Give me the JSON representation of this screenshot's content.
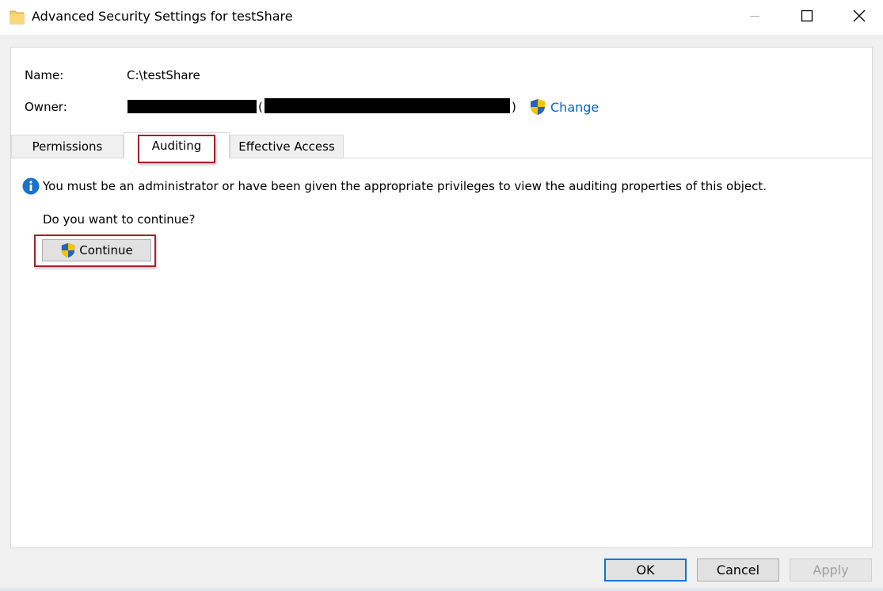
{
  "window": {
    "title": "Advanced Security Settings for testShare",
    "controls": {
      "minimize": "minimize-icon",
      "maximize": "maximize-icon",
      "close": "close-icon"
    }
  },
  "object": {
    "name_label": "Name:",
    "name_value": "C:\\testShare",
    "owner_label": "Owner:",
    "owner_paren_open": "(",
    "owner_paren_close": ")",
    "change_link": "Change"
  },
  "tabs": [
    {
      "label": "Permissions",
      "selected": false
    },
    {
      "label": "Auditing",
      "selected": true
    },
    {
      "label": "Effective Access",
      "selected": false
    }
  ],
  "auditing": {
    "info_message": "You must be an administrator or have been given the appropriate privileges to view the auditing properties of this object.",
    "question": "Do you want to continue?",
    "continue_label": "Continue"
  },
  "footer": {
    "ok_label": "OK",
    "cancel_label": "Cancel",
    "apply_label": "Apply"
  },
  "colors": {
    "link": "#0066cc",
    "highlight": "#a0222a",
    "ok_border": "#0078d7",
    "info_blue": "#1a73c9",
    "shield_blue": "#2a62b8",
    "shield_yellow": "#f5c400"
  }
}
